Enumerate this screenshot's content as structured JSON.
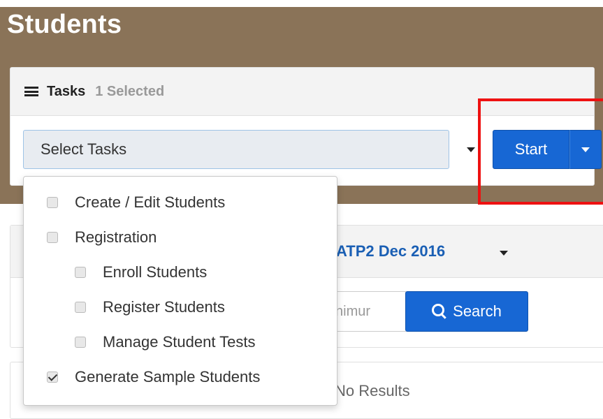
{
  "page": {
    "title": "Students"
  },
  "tasks": {
    "label": "Tasks",
    "selected": "1 Selected",
    "select_placeholder": "Select Tasks",
    "start_label": "Start"
  },
  "search": {
    "admin_value": "ATP2 Dec 2016",
    "min_input_text": "nimur",
    "search_label": "Search"
  },
  "results": {
    "no_results": "No Results"
  },
  "dropdown": {
    "options": [
      {
        "label": "Create / Edit Students",
        "checked": false,
        "indent": 0
      },
      {
        "label": "Registration",
        "checked": false,
        "indent": 0
      },
      {
        "label": "Enroll Students",
        "checked": false,
        "indent": 1
      },
      {
        "label": "Register Students",
        "checked": false,
        "indent": 1
      },
      {
        "label": "Manage Student Tests",
        "checked": false,
        "indent": 1
      },
      {
        "label": "Generate Sample Students",
        "checked": true,
        "indent": 0
      }
    ]
  },
  "colors": {
    "header_brown": "#8a7358",
    "primary_blue": "#1767d4",
    "highlight_red": "#ee1111"
  },
  "icons": [
    "list-icon",
    "chevron-down-icon",
    "search-icon",
    "checkbox-icon"
  ]
}
